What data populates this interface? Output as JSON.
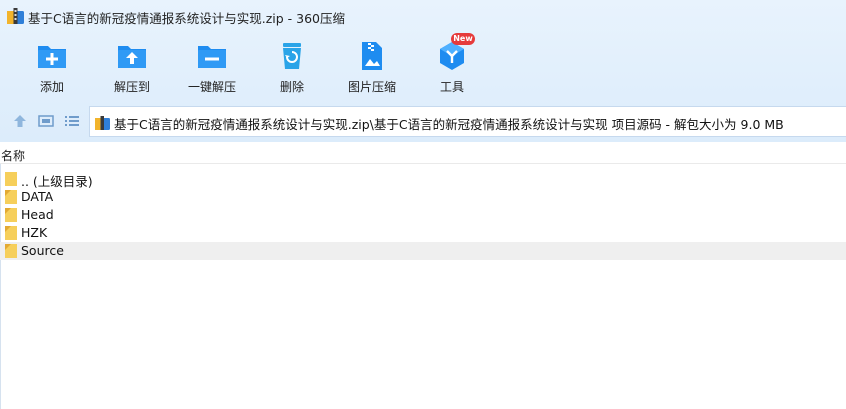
{
  "window": {
    "title": "基于C语言的新冠疫情通报系统设计与实现.zip - 360压缩"
  },
  "toolbar": {
    "items": [
      {
        "label": "添加",
        "icon": "add-folder-icon"
      },
      {
        "label": "解压到",
        "icon": "extract-folder-icon"
      },
      {
        "label": "一键解压",
        "icon": "one-click-extract-icon"
      },
      {
        "label": "删除",
        "icon": "recycle-bin-icon"
      },
      {
        "label": "图片压缩",
        "icon": "image-compress-icon"
      },
      {
        "label": "工具",
        "icon": "tools-cube-icon",
        "badge": "New"
      }
    ]
  },
  "nav": {
    "path": "基于C语言的新冠疫情通报系统设计与实现.zip\\基于C语言的新冠疫情通报系统设计与实现 项目源码 - 解包大小为 9.0 MB"
  },
  "list": {
    "column_name": "名称",
    "rows": [
      {
        "name": ".. (上级目录)",
        "icon": "parent-folder-icon"
      },
      {
        "name": "DATA",
        "icon": "folder-icon"
      },
      {
        "name": "Head",
        "icon": "folder-icon"
      },
      {
        "name": "HZK",
        "icon": "folder-icon"
      },
      {
        "name": "Source",
        "icon": "folder-icon",
        "selected": true
      }
    ]
  },
  "colors": {
    "toolbar_blue": "#1e8cf0",
    "delete_cyan": "#2aa4e8",
    "badge_red": "#e63b3b",
    "folder_yellow": "#f6cf5b",
    "selected_row": "#efefef"
  }
}
